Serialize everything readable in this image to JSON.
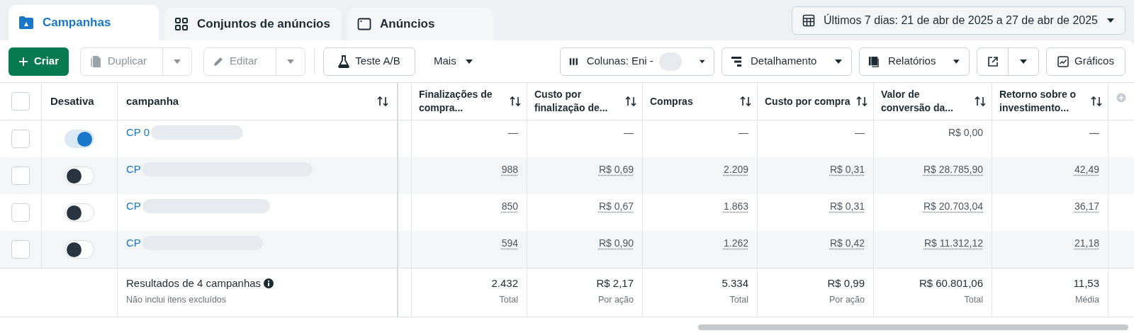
{
  "tabs": [
    {
      "label": "Campanhas",
      "kind": "folder",
      "selected": true
    },
    {
      "label": "Conjuntos de anúncios",
      "kind": "grid",
      "selected": false
    },
    {
      "label": "Anúncios",
      "kind": "window",
      "selected": false
    }
  ],
  "date_range": "Últimos 7 dias: 21 de abr de 2025 a 27 de abr de 2025",
  "toolbar": {
    "create": "Criar",
    "duplicate": "Duplicar",
    "edit": "Editar",
    "ab_test": "Teste A/B",
    "more": "Mais",
    "columns": "Colunas: Eni -",
    "breakdown": "Detalhamento",
    "reports": "Relatórios",
    "charts": "Gráficos"
  },
  "table": {
    "select_all_checked": false,
    "columns": [
      {
        "label": "Desativa"
      },
      {
        "label": "campanha"
      },
      {
        "label": "Finalizações de compra..."
      },
      {
        "label": "Custo por finalização de..."
      },
      {
        "label": "Compras"
      },
      {
        "label": "Custo por compra"
      },
      {
        "label": "Valor de conversão da..."
      },
      {
        "label": "Retorno sobre o investimento..."
      }
    ],
    "rows": [
      {
        "checked": false,
        "on": true,
        "name": "CP 0",
        "values": [
          "—",
          "—",
          "—",
          "—",
          "R$ 0,00",
          "—"
        ]
      },
      {
        "checked": false,
        "on": false,
        "name": "CP",
        "values": [
          "988",
          "R$ 0,69",
          "2.209",
          "R$ 0,31",
          "R$ 28.785,90",
          "42,49"
        ]
      },
      {
        "checked": false,
        "on": false,
        "name": "CP",
        "values": [
          "850",
          "R$ 0,67",
          "1.863",
          "R$ 0,31",
          "R$ 20.703,04",
          "36,17"
        ]
      },
      {
        "checked": false,
        "on": false,
        "name": "CP",
        "values": [
          "594",
          "R$ 0,90",
          "1.262",
          "R$ 0,42",
          "R$ 11.312,12",
          "21,18"
        ]
      }
    ],
    "footer": {
      "title": "Resultados de 4 campanhas",
      "note": "Não inclui itens excluídos",
      "totals": [
        {
          "value": "2.432",
          "label": "Total"
        },
        {
          "value": "R$ 2,17",
          "label": "Por ação"
        },
        {
          "value": "5.334",
          "label": "Total"
        },
        {
          "value": "R$ 0,99",
          "label": "Por ação"
        },
        {
          "value": "R$ 60.801,06",
          "label": "Total"
        },
        {
          "value": "11,53",
          "label": "Média"
        }
      ]
    }
  }
}
